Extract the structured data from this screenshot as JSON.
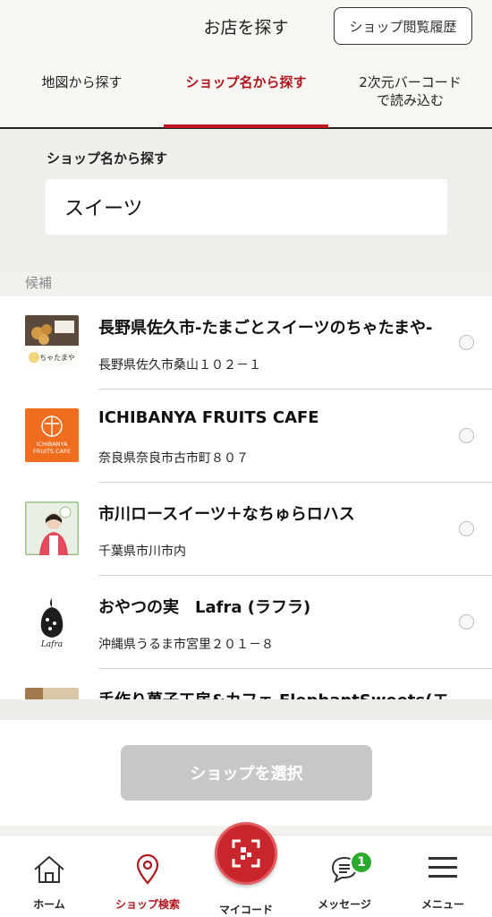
{
  "header": {
    "title": "お店を探す",
    "history_button": "ショップ閲覧履歴"
  },
  "tabs": [
    {
      "label": "地図から探す",
      "active": false
    },
    {
      "label": "ショップ名から探す",
      "active": true
    },
    {
      "label": "2次元バーコード\nで読み込む",
      "active": false
    }
  ],
  "search": {
    "label": "ショップ名から探す",
    "value": "スイーツ",
    "placeholder": ""
  },
  "candidates_label": "候補",
  "shops": [
    {
      "name": "長野県佐久市-たまごとスイーツのちゃたまや-",
      "address": "長野県佐久市桑山１０２－１",
      "logo": "chatamaya-logo",
      "logo_text": "ちゃたまや",
      "selected": false
    },
    {
      "name": "ICHIBANYA FRUITS CAFE",
      "address": "奈良県奈良市古市町８０７",
      "logo": "ichibanya-logo",
      "logo_text": "ICHIBANYA\nFRUITS CAFE",
      "selected": false
    },
    {
      "name": "市川ロースイーツ＋なちゅらロハス",
      "address": "千葉県市川市内",
      "logo": "ichikawa-photo",
      "selected": false
    },
    {
      "name": "おやつの実　Lafra (ラフラ)",
      "address": "沖縄県うるま市宮里２０１－８",
      "logo": "lafra-logo",
      "logo_text": "Lafra",
      "selected": false
    },
    {
      "name": "手作り菓子工房&カフェ ElephantSweets(エ",
      "address": "",
      "logo": "elephant-photo",
      "selected": false
    }
  ],
  "select_button": "ショップを選択",
  "tabbar": {
    "home": "ホーム",
    "shop_search": "ショップ検索",
    "mycode": "マイコード",
    "messages": "メッセージ",
    "messages_badge": "1",
    "menu": "メニュー"
  },
  "colors": {
    "accent": "#b1151c",
    "badge": "#2bab2e",
    "orange_logo": "#f06c1e"
  }
}
